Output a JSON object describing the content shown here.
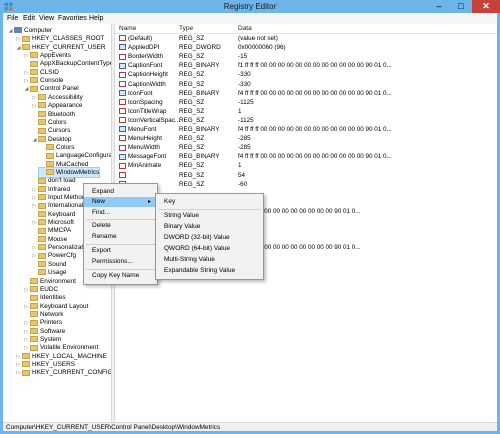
{
  "window": {
    "title": "Registry Editor",
    "buttons": {
      "minimize": "–",
      "maximize": "□",
      "close": "✕"
    }
  },
  "menu": [
    "File",
    "Edit",
    "View",
    "Favorites",
    "Help"
  ],
  "tree": [
    {
      "label": "Computer",
      "kind": "pc",
      "exp": "◢"
    },
    {
      "label": "HKEY_CLASSES_ROOT",
      "kind": "folder",
      "exp": "▷"
    },
    {
      "label": "HKEY_CURRENT_USER",
      "kind": "folder",
      "exp": "◢"
    },
    {
      "label": "AppEvents",
      "kind": "folder",
      "exp": "▷"
    },
    {
      "label": "AppXBackupContentType",
      "kind": "folder",
      "exp": ""
    },
    {
      "label": "CLSID",
      "kind": "folder",
      "exp": "▷"
    },
    {
      "label": "Console",
      "kind": "folder",
      "exp": "▷"
    },
    {
      "label": "Control Panel",
      "kind": "folder",
      "exp": "◢"
    },
    {
      "label": "Accessibility",
      "kind": "folder",
      "exp": "▷"
    },
    {
      "label": "Appearance",
      "kind": "folder",
      "exp": "▷"
    },
    {
      "label": "Bluetooth",
      "kind": "folder",
      "exp": ""
    },
    {
      "label": "Colors",
      "kind": "folder",
      "exp": ""
    },
    {
      "label": "Cursors",
      "kind": "folder",
      "exp": ""
    },
    {
      "label": "Desktop",
      "kind": "folder",
      "exp": "◢"
    },
    {
      "label": "Colors",
      "kind": "folder",
      "exp": ""
    },
    {
      "label": "LanguageConfiguration",
      "kind": "folder",
      "exp": ""
    },
    {
      "label": "MuiCached",
      "kind": "folder",
      "exp": ""
    },
    {
      "label": "WindowMetrics",
      "kind": "folder",
      "exp": "",
      "selected": true
    },
    {
      "label": "don't load",
      "kind": "folder",
      "exp": ""
    },
    {
      "label": "Infrared",
      "kind": "folder",
      "exp": "▷"
    },
    {
      "label": "Input Method",
      "kind": "folder",
      "exp": "▷"
    },
    {
      "label": "International",
      "kind": "folder",
      "exp": "▷"
    },
    {
      "label": "Keyboard",
      "kind": "folder",
      "exp": ""
    },
    {
      "label": "Microsoft",
      "kind": "folder",
      "exp": "▷"
    },
    {
      "label": "MMCPA",
      "kind": "folder",
      "exp": ""
    },
    {
      "label": "Mouse",
      "kind": "folder",
      "exp": ""
    },
    {
      "label": "Personalization",
      "kind": "folder",
      "exp": "▷"
    },
    {
      "label": "PowerCfg",
      "kind": "folder",
      "exp": "▷"
    },
    {
      "label": "Sound",
      "kind": "folder",
      "exp": ""
    },
    {
      "label": "Usage",
      "kind": "folder",
      "exp": ""
    },
    {
      "label": "Environment",
      "kind": "folder",
      "exp": ""
    },
    {
      "label": "EUDC",
      "kind": "folder",
      "exp": "▷"
    },
    {
      "label": "Identities",
      "kind": "folder",
      "exp": ""
    },
    {
      "label": "Keyboard Layout",
      "kind": "folder",
      "exp": "▷"
    },
    {
      "label": "Network",
      "kind": "folder",
      "exp": ""
    },
    {
      "label": "Printers",
      "kind": "folder",
      "exp": "▷"
    },
    {
      "label": "Software",
      "kind": "folder",
      "exp": "▷"
    },
    {
      "label": "System",
      "kind": "folder",
      "exp": "▷"
    },
    {
      "label": "Volatile Environment",
      "kind": "folder",
      "exp": "▷"
    },
    {
      "label": "HKEY_LOCAL_MACHINE",
      "kind": "folder",
      "exp": "▷"
    },
    {
      "label": "HKEY_USERS",
      "kind": "folder",
      "exp": "▷"
    },
    {
      "label": "HKEY_CURRENT_CONFIG",
      "kind": "folder",
      "exp": "▷"
    }
  ],
  "list": {
    "headers": [
      "Name",
      "Type",
      "Data"
    ],
    "rows": [
      {
        "name": "(Default)",
        "type": "REG_SZ",
        "data": "(value not set)",
        "icon": "sz"
      },
      {
        "name": "AppliedDPI",
        "type": "REG_DWORD",
        "data": "0x00000060 (96)",
        "icon": "bin"
      },
      {
        "name": "BorderWidth",
        "type": "REG_SZ",
        "data": "-15",
        "icon": "sz"
      },
      {
        "name": "CaptionFont",
        "type": "REG_BINARY",
        "data": "f1 ff ff ff 00 00 00 00 00 00 00 00 00 00 00 00 90 01 0...",
        "icon": "bin"
      },
      {
        "name": "CaptionHeight",
        "type": "REG_SZ",
        "data": "-330",
        "icon": "sz"
      },
      {
        "name": "CaptionWidth",
        "type": "REG_SZ",
        "data": "-330",
        "icon": "sz"
      },
      {
        "name": "IconFont",
        "type": "REG_BINARY",
        "data": "f4 ff ff ff 00 00 00 00 00 00 00 00 00 00 00 00 90 01 0...",
        "icon": "bin"
      },
      {
        "name": "IconSpacing",
        "type": "REG_SZ",
        "data": "-1125",
        "icon": "sz"
      },
      {
        "name": "IconTitleWrap",
        "type": "REG_SZ",
        "data": "1",
        "icon": "sz"
      },
      {
        "name": "IconVerticalSpac...",
        "type": "REG_SZ",
        "data": "-1125",
        "icon": "sz"
      },
      {
        "name": "MenuFont",
        "type": "REG_BINARY",
        "data": "f4 ff ff ff 00 00 00 00 00 00 00 00 00 00 00 00 90 01 0...",
        "icon": "bin"
      },
      {
        "name": "MenuHeight",
        "type": "REG_SZ",
        "data": "-285",
        "icon": "sz"
      },
      {
        "name": "MenuWidth",
        "type": "REG_SZ",
        "data": "-285",
        "icon": "sz"
      },
      {
        "name": "MessageFont",
        "type": "REG_BINARY",
        "data": "f4 ff ff ff 00 00 00 00 00 00 00 00 00 00 00 00 90 01 0...",
        "icon": "bin"
      },
      {
        "name": "MinAnimate",
        "type": "REG_SZ",
        "data": "1",
        "icon": "sz"
      },
      {
        "name": "",
        "type": "REG_SZ",
        "data": "54",
        "icon": "sz"
      },
      {
        "name": "",
        "type": "REG_SZ",
        "data": "-60",
        "icon": "sz"
      },
      {
        "name": "",
        "type": "",
        "data": "",
        "icon": ""
      },
      {
        "name": "",
        "type": "",
        "data": "",
        "icon": ""
      },
      {
        "name": "",
        "type": "",
        "data": "00 00 00 00 00 00 00 00 00 00 00 90 01 0...",
        "icon": ""
      },
      {
        "name": "",
        "type": "",
        "data": "",
        "icon": ""
      },
      {
        "name": "",
        "type": "",
        "data": "",
        "icon": ""
      },
      {
        "name": "",
        "type": "",
        "data": "",
        "icon": ""
      },
      {
        "name": "",
        "type": "",
        "data": "00 00 00 00 00 00 00 00 00 00 00 90 01 0...",
        "icon": ""
      }
    ]
  },
  "context_menu": {
    "items": [
      "Expand",
      "New",
      "Find...",
      "Delete",
      "Rename",
      "Export",
      "Permissions...",
      "Copy Key Name"
    ],
    "submenu_arrow": "▸",
    "highlighted": "New"
  },
  "new_submenu": {
    "items": [
      "Key",
      "String Value",
      "Binary Value",
      "DWORD (32-bit) Value",
      "QWORD (64-bit) Value",
      "Multi-String Value",
      "Expandable String Value"
    ]
  },
  "status": "Computer\\HKEY_CURRENT_USER\\Control Panel\\Desktop\\WindowMetrics"
}
